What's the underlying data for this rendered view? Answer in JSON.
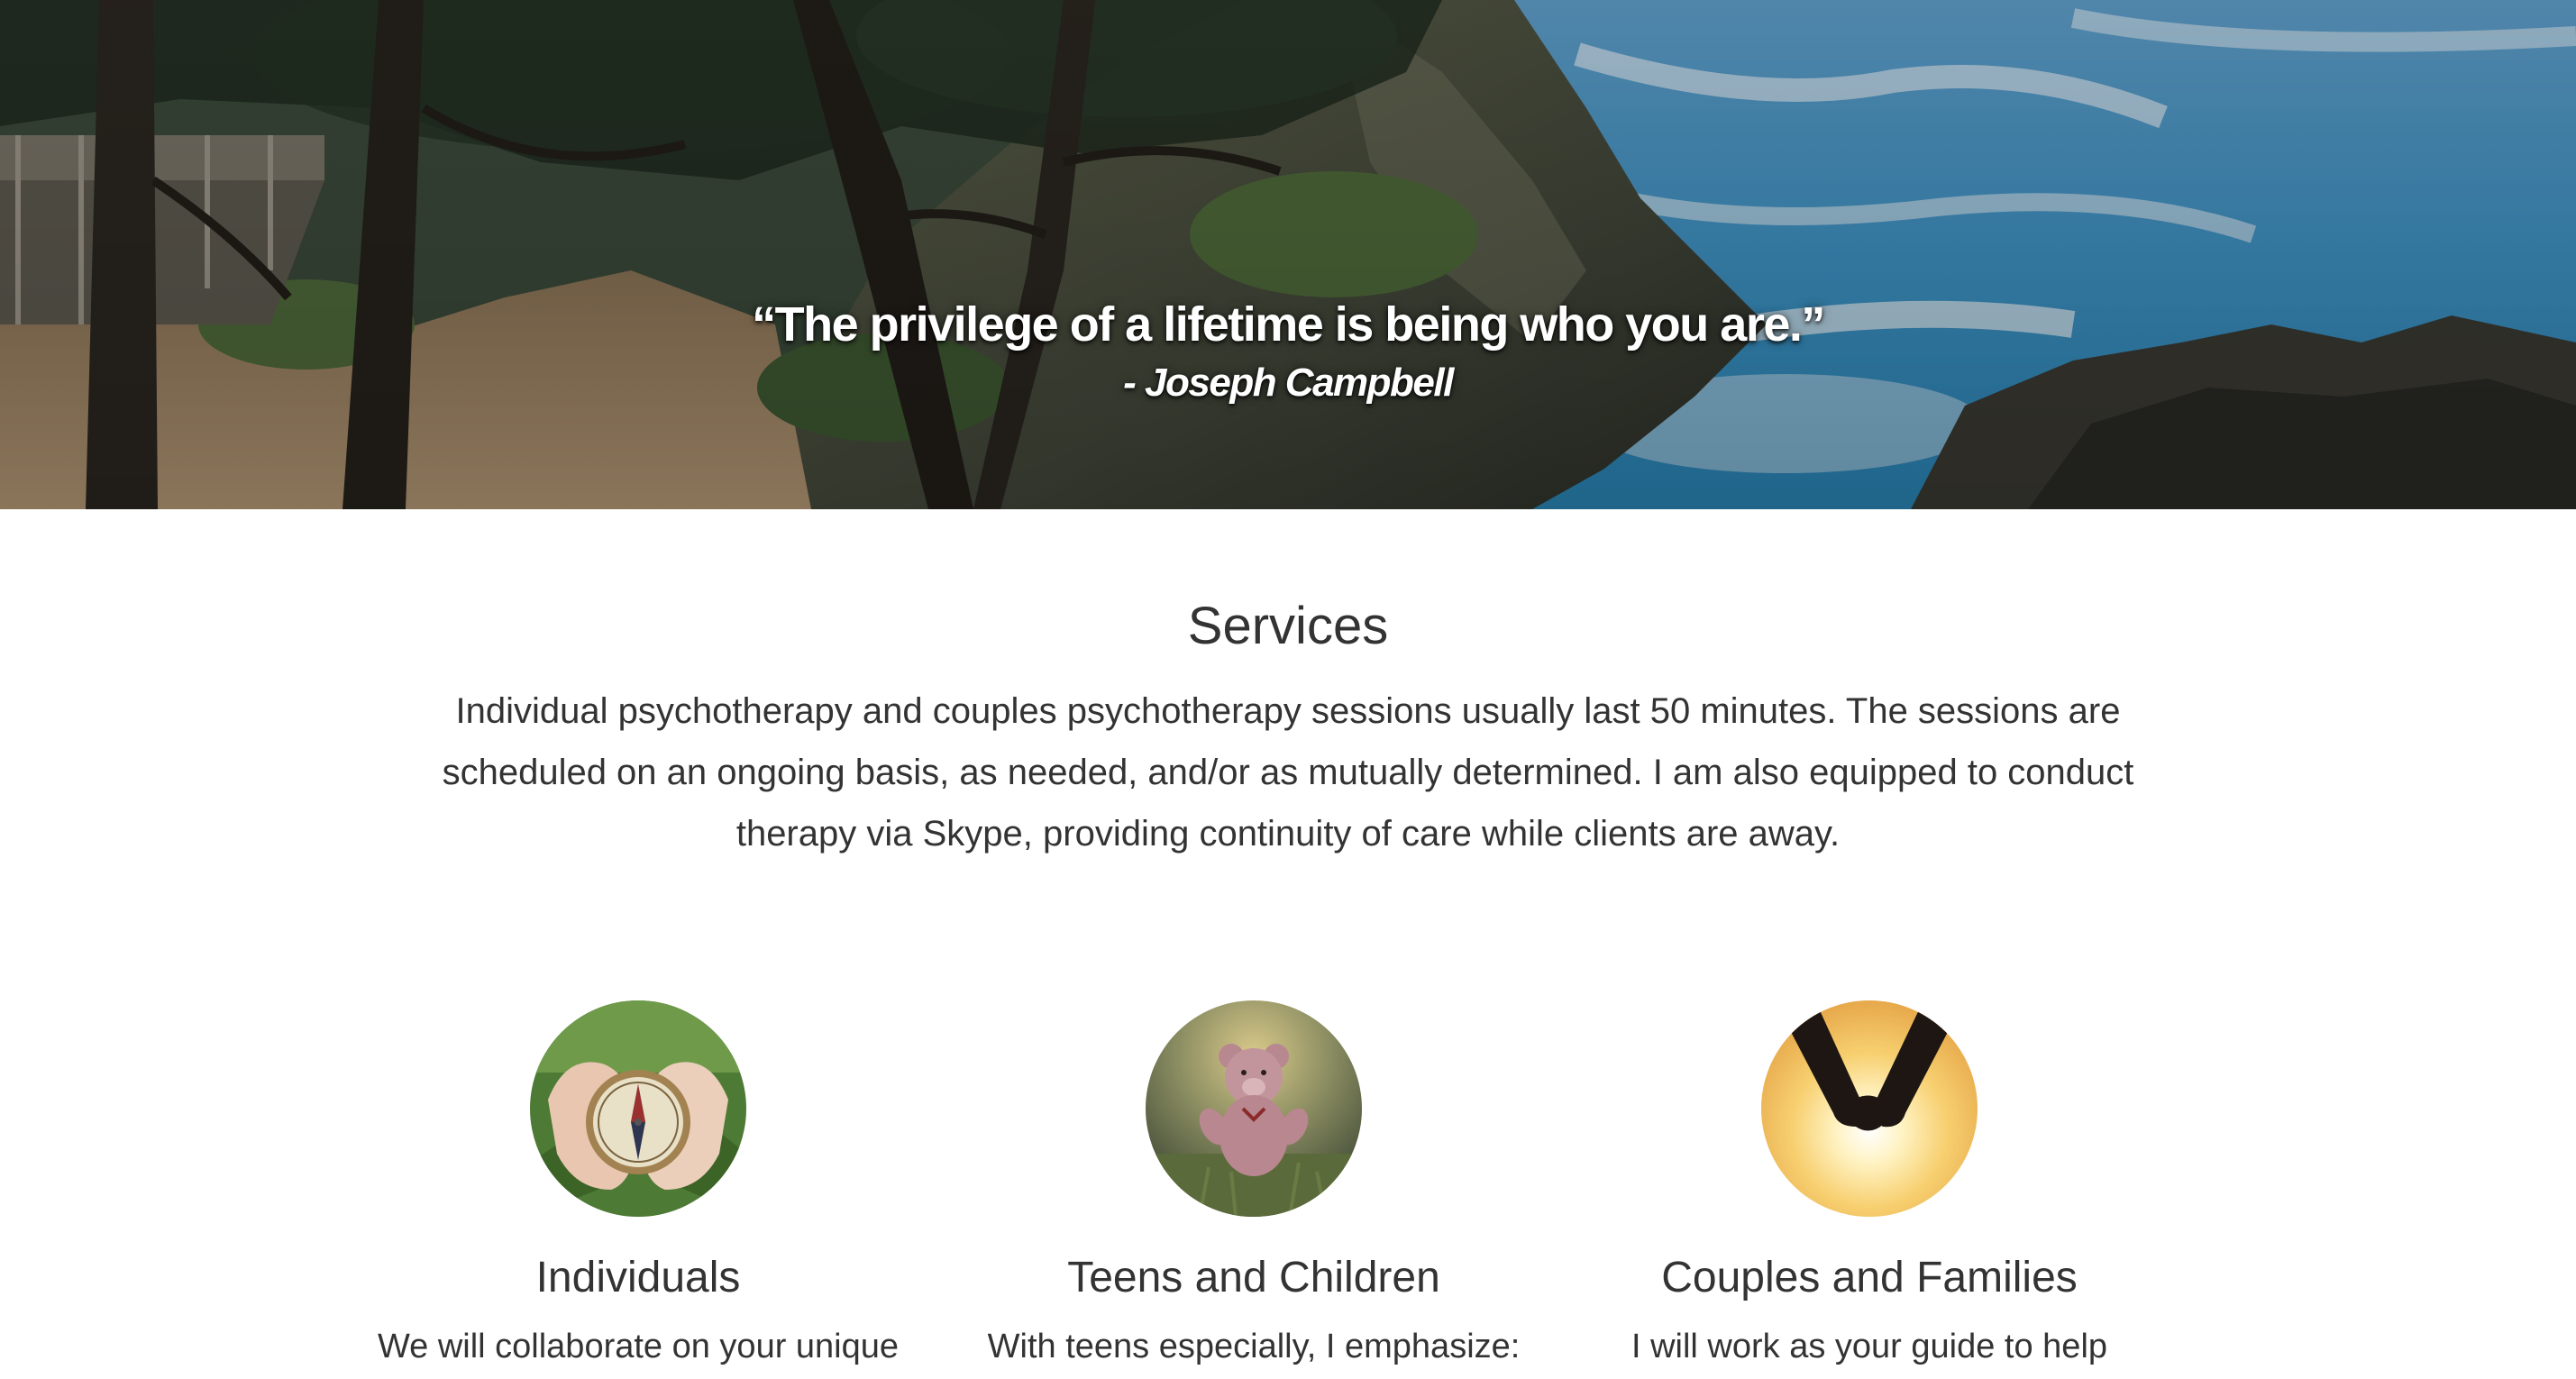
{
  "hero": {
    "quote": "“The privilege of a lifetime is being who you are.”",
    "author": "- Joseph Campbell"
  },
  "services": {
    "title": "Services",
    "description": "Individual psychotherapy and couples psychotherapy sessions usually last 50 minutes. The sessions are scheduled on an ongoing basis, as needed, and/or as mutually determined. I am also equipped to conduct therapy via Skype, providing continuity of care while clients are away.",
    "cards": [
      {
        "title": "Individuals",
        "text": "We will collaborate on your unique",
        "image": "compass-in-hands-image"
      },
      {
        "title": "Teens and Children",
        "text": "With teens especially, I emphasize:",
        "image": "teddy-bear-image"
      },
      {
        "title": "Couples and Families",
        "text": "I will work as your guide to help",
        "image": "holding-hands-image"
      }
    ]
  },
  "colors": {
    "text": "#333333",
    "background": "#ffffff",
    "ocean": "#3a8fc4"
  }
}
